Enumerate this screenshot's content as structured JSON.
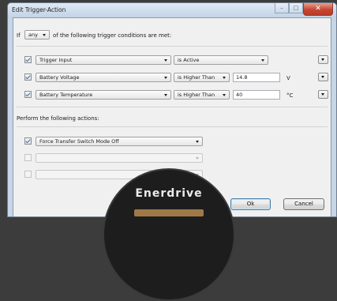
{
  "window": {
    "title": "Edit Trigger-Action",
    "close_glyph": "✕",
    "min_glyph": "–",
    "max_glyph": "□"
  },
  "condition_line": {
    "prefix": "If",
    "match_value": "any",
    "suffix": "of the following trigger conditions are met:"
  },
  "conditions": [
    {
      "checked": true,
      "field": "Trigger Input",
      "operator": "is Active",
      "value": "",
      "unit": ""
    },
    {
      "checked": true,
      "field": "Battery Voltage",
      "operator": "is Higher Than",
      "value": "14.8",
      "unit": "V"
    },
    {
      "checked": true,
      "field": "Battery Temperature",
      "operator": "is Higher Than",
      "value": "40",
      "unit": "°C"
    }
  ],
  "actions_heading": "Perform the following actions:",
  "actions": [
    {
      "checked": true,
      "action": "Force Transfer Switch Mode Off"
    },
    {
      "checked": false,
      "action": ""
    },
    {
      "checked": false,
      "action": ""
    }
  ],
  "buttons": {
    "ok": "Ok",
    "cancel": "Cancel"
  },
  "logo": {
    "text": "Enerdrive"
  },
  "colors": {
    "accent": "#3c7fb1",
    "close": "#c74532",
    "checkmark": "#3a6fbf"
  },
  "icons": [
    "close-icon",
    "minimize-icon",
    "maximize-icon",
    "dropdown-arrow-icon",
    "checkmark-icon",
    "row-menu-icon"
  ]
}
